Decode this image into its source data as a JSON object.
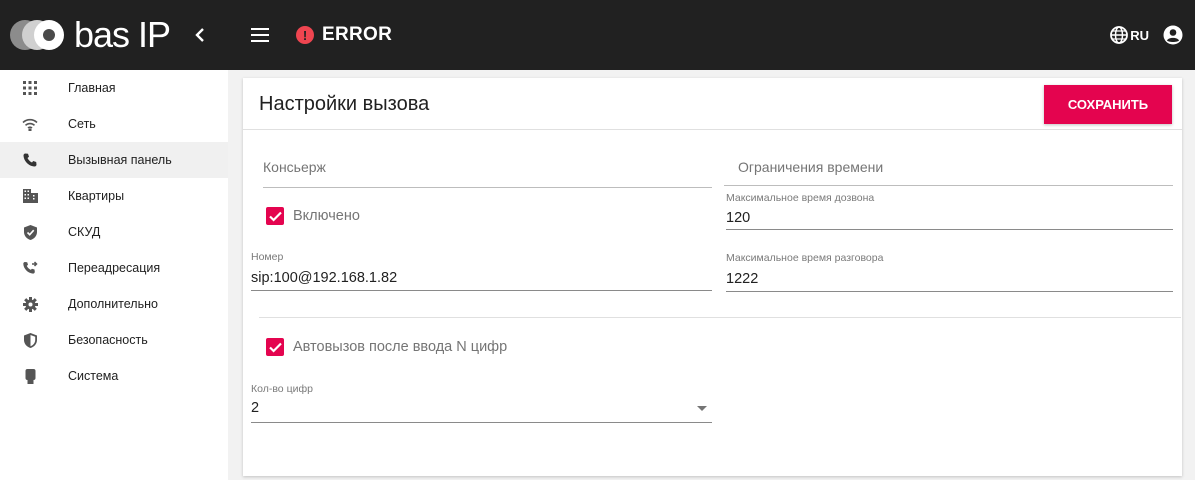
{
  "header": {
    "logo_text": "bas IP",
    "status_text": "ERROR",
    "status_icon": "!",
    "language": "RU"
  },
  "sidebar": {
    "items": [
      {
        "label": "Главная",
        "icon": "grid-icon"
      },
      {
        "label": "Сеть",
        "icon": "wifi-icon"
      },
      {
        "label": "Вызывная панель",
        "icon": "phone-icon",
        "active": true
      },
      {
        "label": "Квартиры",
        "icon": "building-icon"
      },
      {
        "label": "СКУД",
        "icon": "shield-check-icon"
      },
      {
        "label": "Переадресация",
        "icon": "phone-forward-icon"
      },
      {
        "label": "Дополнительно",
        "icon": "gear-icon"
      },
      {
        "label": "Безопасность",
        "icon": "security-shield-icon"
      },
      {
        "label": "Система",
        "icon": "device-icon"
      }
    ]
  },
  "card": {
    "title": "Настройки вызова",
    "save_label": "СОХРАНИТЬ"
  },
  "concierge": {
    "section_title": "Консьерж",
    "enabled_label": "Включено",
    "enabled": true,
    "number_label": "Номер",
    "number_value": "sip:100@192.168.1.82"
  },
  "time_limits": {
    "section_title": "Ограничения времени",
    "max_dial_label": "Максимальное время дозвона",
    "max_dial_value": "120",
    "max_talk_label": "Максимальное время разговора",
    "max_talk_value": "1222"
  },
  "autocall": {
    "label": "Автовызов после ввода N цифр",
    "enabled": true,
    "digits_label": "Кол-во цифр",
    "digits_value": "2"
  },
  "colors": {
    "accent": "#e4044f",
    "topbar": "#212121",
    "error": "#ef4550"
  }
}
